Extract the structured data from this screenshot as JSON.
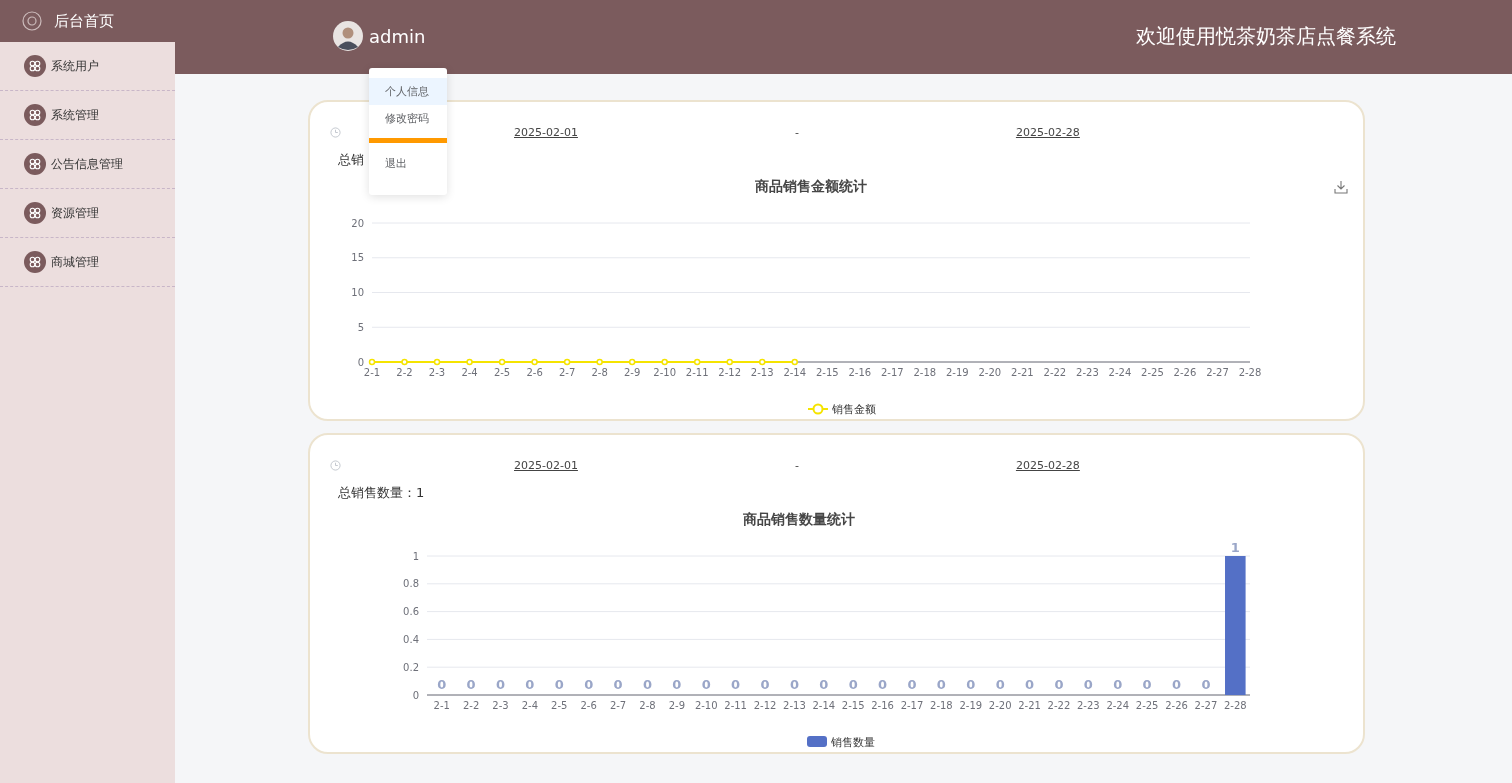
{
  "sidebar": {
    "home": "后台首页",
    "items": [
      {
        "label": "系统用户"
      },
      {
        "label": "系统管理"
      },
      {
        "label": "公告信息管理"
      },
      {
        "label": "资源管理"
      },
      {
        "label": "商城管理"
      }
    ]
  },
  "header": {
    "username": "admin",
    "title": "欢迎使用悦茶奶茶店点餐系统"
  },
  "user_menu": {
    "items": [
      {
        "label": "个人信息",
        "selected": true
      },
      {
        "label": "修改密码",
        "selected": false
      },
      {
        "label": "退出",
        "selected": false
      }
    ]
  },
  "panels": [
    {
      "start_date": "2025-02-01",
      "separator": "-",
      "end_date": "2025-02-28",
      "total": "总销",
      "download": true,
      "chart_data": {
        "type": "line",
        "title": "商品销售金额统计",
        "categories": [
          "2-1",
          "2-2",
          "2-3",
          "2-4",
          "2-5",
          "2-6",
          "2-7",
          "2-8",
          "2-9",
          "2-10",
          "2-11",
          "2-12",
          "2-13",
          "2-14",
          "2-15",
          "2-16",
          "2-17",
          "2-18",
          "2-19",
          "2-20",
          "2-21",
          "2-22",
          "2-23",
          "2-24",
          "2-25",
          "2-26",
          "2-27",
          "2-28"
        ],
        "ylim": [
          0,
          20
        ],
        "yticks": [
          0,
          5,
          10,
          15,
          20
        ],
        "grid": true,
        "series": [
          {
            "name": "销售金额",
            "color": "#f5e400",
            "marker": true,
            "values": [
              0,
              0,
              0,
              0,
              0,
              0,
              0,
              0,
              0,
              0,
              0,
              0,
              0,
              0,
              null,
              null,
              null,
              null,
              null,
              null,
              null,
              null,
              null,
              null,
              null,
              null,
              null,
              null
            ]
          }
        ]
      }
    },
    {
      "start_date": "2025-02-01",
      "separator": "-",
      "end_date": "2025-02-28",
      "total": "总销售数量：1",
      "chart_data": {
        "type": "bar",
        "title": "商品销售数量统计",
        "categories": [
          "2-1",
          "2-2",
          "2-3",
          "2-4",
          "2-5",
          "2-6",
          "2-7",
          "2-8",
          "2-9",
          "2-10",
          "2-11",
          "2-12",
          "2-13",
          "2-14",
          "2-15",
          "2-16",
          "2-17",
          "2-18",
          "2-19",
          "2-20",
          "2-21",
          "2-22",
          "2-23",
          "2-24",
          "2-25",
          "2-26",
          "2-27",
          "2-28"
        ],
        "ylim": [
          0,
          1
        ],
        "yticks": [
          0,
          {
            "value": 0.2,
            "label": "0.2"
          },
          {
            "value": 0.4,
            "label": "0.4"
          },
          {
            "value": 0.6,
            "label": "0.6"
          },
          {
            "value": 0.8,
            "label": "0.8"
          },
          1
        ],
        "data_labels": true,
        "grid": true,
        "series": [
          {
            "name": "销售数量",
            "color": "#5470c6",
            "values": [
              0,
              0,
              0,
              0,
              0,
              0,
              0,
              0,
              0,
              0,
              0,
              0,
              0,
              0,
              0,
              0,
              0,
              0,
              0,
              0,
              0,
              0,
              0,
              0,
              0,
              0,
              0,
              1
            ]
          }
        ]
      }
    }
  ]
}
